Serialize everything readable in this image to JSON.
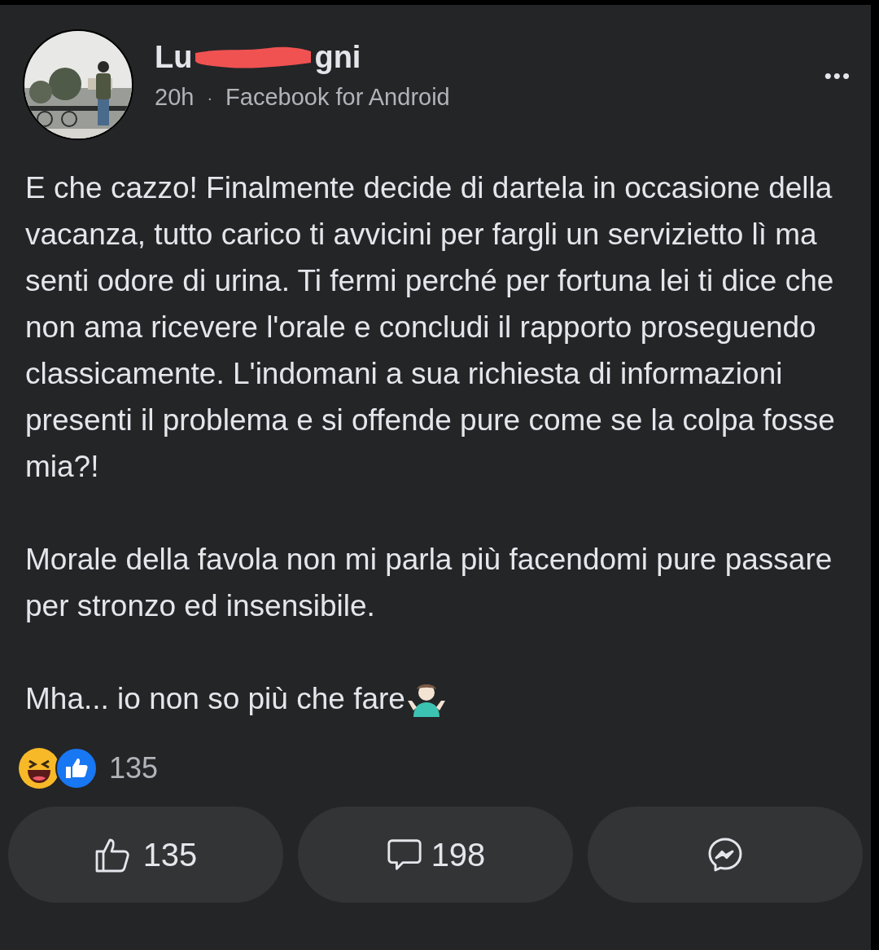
{
  "post": {
    "author_parts": [
      "Lu",
      "gni"
    ],
    "time": "20h",
    "separator": "·",
    "source": "Facebook for Android",
    "more": "•••",
    "paragraphs": [
      "E che cazzo! Finalmente decide di dartela in occasione della vacanza, tutto carico ti avvicini per fargli un servizietto lì ma senti odore di urina. Ti fermi perché per fortuna lei ti dice che non ama ricevere l'orale e concludi il rapporto proseguendo classicamente. L'indomani a sua richiesta di informazioni presenti il problema e si offende pure come se la colpa fosse mia?!",
      "Morale della favola non mi parla più facendomi pure passare per stronzo ed insensibile.",
      "Mha... io non so più che fare"
    ],
    "reaction_count": "135",
    "actions": [
      {
        "kind": "like",
        "label": "135"
      },
      {
        "kind": "comment",
        "label": "198"
      },
      {
        "kind": "share"
      }
    ]
  }
}
